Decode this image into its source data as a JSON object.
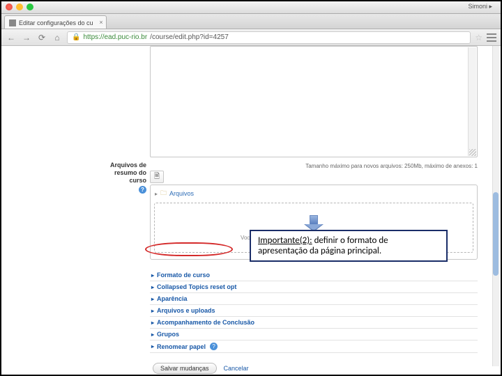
{
  "window": {
    "user": "Simoni ▸",
    "tab_title": "Editar configurações do cu",
    "url_host": "https://ead.puc-rio.br",
    "url_path": "/course/edit.php?id=4257"
  },
  "upload": {
    "label_l1": "Arquivos de",
    "label_l2": "resumo do",
    "label_l3": "curso",
    "hint": "Tamanho máximo para novos arquivos: 250Mb, máximo de anexos: 1",
    "path": "Arquivos",
    "drop_hint": "Você pode arrastar e soltar o arquivo aqui para adicioná-lo.",
    "foot": ""
  },
  "sections": [
    {
      "label": "Formato de curso"
    },
    {
      "label": "Collapsed Topics reset opt"
    },
    {
      "label": "Aparência"
    },
    {
      "label": "Arquivos e uploads"
    },
    {
      "label": "Acompanhamento de Conclusão"
    },
    {
      "label": "Grupos"
    },
    {
      "label": "Renomear papel",
      "help": true
    }
  ],
  "callout": {
    "l1_a": "Importante(2):",
    "l1_b": " definir o formato de",
    "l2": "apresentação da página principal."
  },
  "buttons": {
    "save": "Salvar mudanças",
    "cancel": "Cancelar"
  }
}
